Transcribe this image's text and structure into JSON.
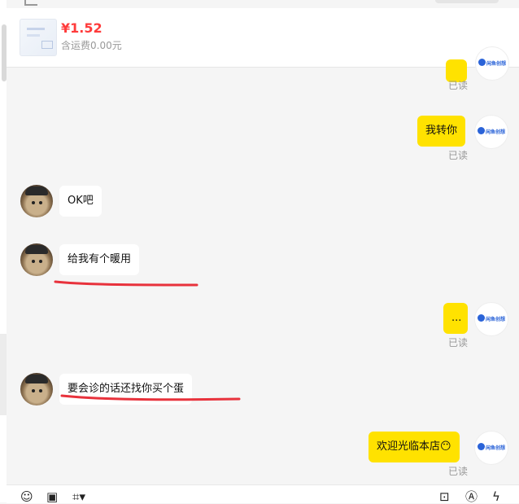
{
  "product": {
    "price": "¥1.52",
    "shipping": "含运费0.00元"
  },
  "brand_avatar_text": "闲鱼创想",
  "messages": [
    {
      "from": "me",
      "text": "",
      "status": "已读"
    },
    {
      "from": "me",
      "text": "我转你",
      "status": "已读"
    },
    {
      "from": "them",
      "text": "OK吧"
    },
    {
      "from": "them",
      "text": "给我有个暖用"
    },
    {
      "from": "me",
      "text": "...",
      "status": "已读"
    },
    {
      "from": "them",
      "text": "要会诊的话还找你买个蛋"
    },
    {
      "from": "me",
      "text": "欢迎光临本店😶",
      "status": "已读"
    }
  ],
  "toolbar": {
    "left": [
      "emoji-icon",
      "image-icon",
      "quick-reply-icon"
    ],
    "right": [
      "order-icon",
      "ai-icon",
      "lightning-icon"
    ]
  },
  "colors": {
    "accent_yellow": "#ffe200",
    "price_red": "#ff3b3b",
    "underline_red": "#e8323c"
  }
}
